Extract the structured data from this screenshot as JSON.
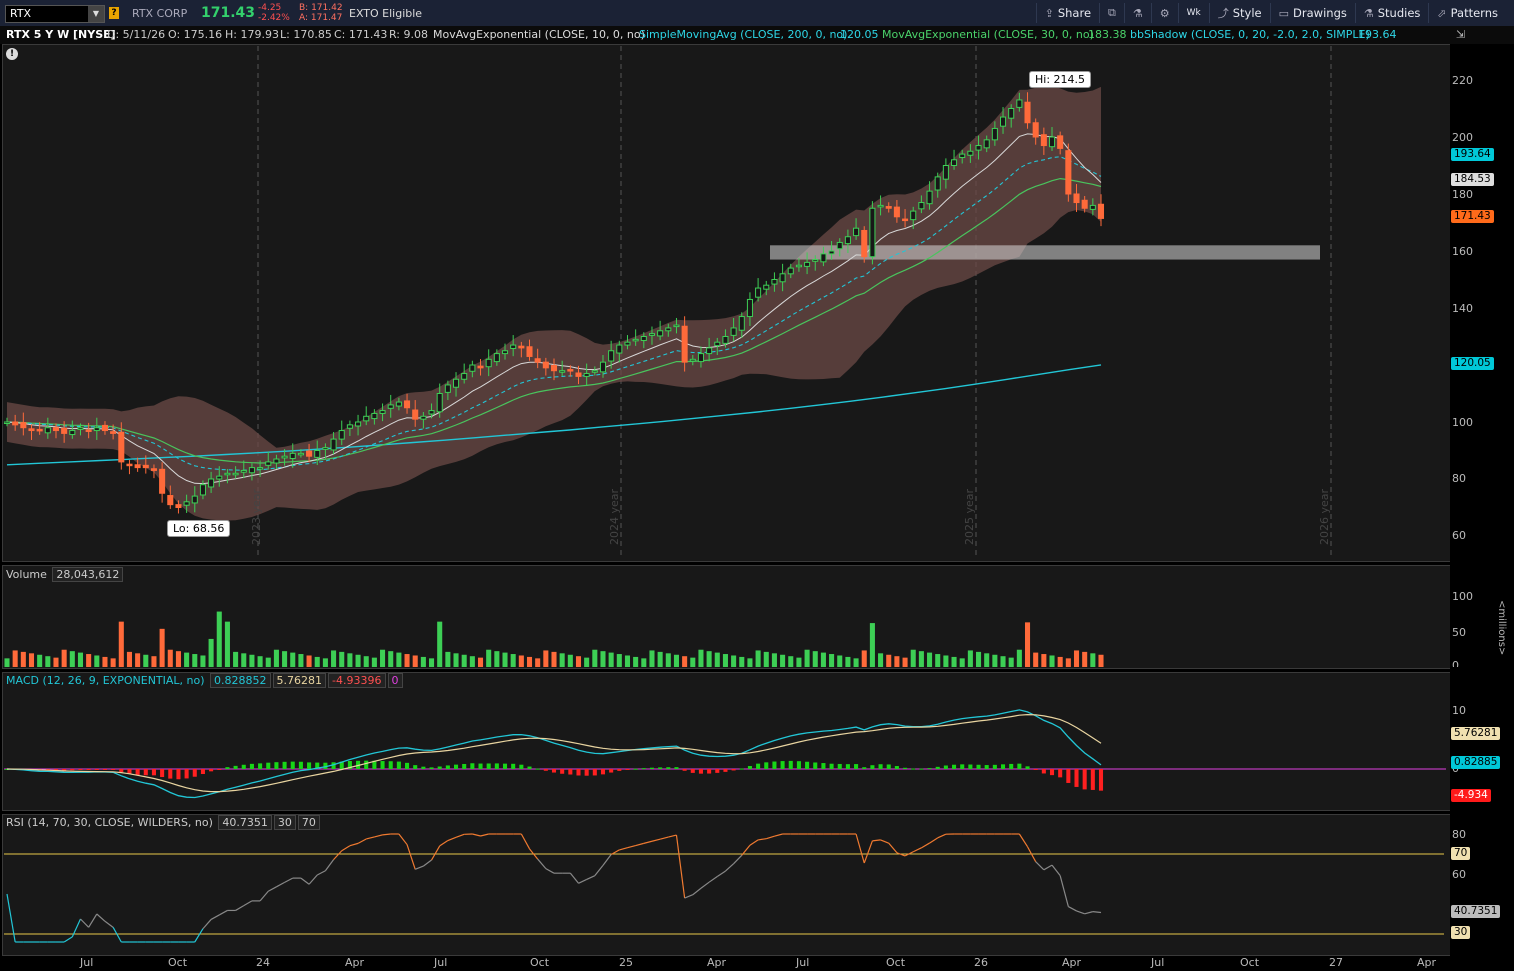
{
  "header": {
    "symbol": "RTX",
    "company": "RTX CORP",
    "last": "171.43",
    "change": "-4.25",
    "change_pct": "-2.42%",
    "bid": "B: 171.42",
    "ask": "A: 171.47",
    "exto": "EXTO Eligible"
  },
  "toolbar": {
    "share": "Share",
    "aggregation": "Wk",
    "style": "Style",
    "drawings": "Drawings",
    "studies": "Studies",
    "patterns": "Patterns"
  },
  "studybar": {
    "title": "RTX 5 Y W [NYSE]",
    "date": "D: 5/11/26",
    "open": "O: 175.16",
    "high": "H: 179.93",
    "low": "L: 170.85",
    "close": "C: 171.43",
    "range": "R: 9.08",
    "ema10": "MovAvgExponential (CLOSE, 10, 0, no)",
    "sma200": "SimpleMovingAvg (CLOSE, 200, 0, no)",
    "sma200_val": "120.05",
    "ema30": "MovAvgExponential (CLOSE, 30, 0, no)",
    "ema30_val": "183.38",
    "bb": "bbShadow (CLOSE, 0, 20, -2.0, 2.0, SIMPLE)",
    "bb_val": "193.64"
  },
  "price_pane": {
    "y_ticks": [
      "220",
      "200",
      "180",
      "160",
      "140",
      "100",
      "80",
      "60"
    ],
    "hi_label": "Hi: 214.5",
    "lo_label": "Lo: 68.56",
    "tag_bb": "193.64",
    "tag_ema": "184.53",
    "tag_last": "171.43",
    "tag_sma": "120.05",
    "years": [
      "2023 year",
      "2024 year",
      "2025 year",
      "2026 year"
    ]
  },
  "volume_pane": {
    "label": "Volume",
    "value": "28,043,612",
    "y_ticks": [
      "100",
      "50",
      "0"
    ],
    "units": "<millions>"
  },
  "macd_pane": {
    "label": "MACD (12, 26, 9, EXPONENTIAL, no)",
    "value": "0.828852",
    "avg": "5.76281",
    "diff": "-4.93396",
    "zero": "0",
    "y_ticks": [
      "10",
      "0"
    ],
    "tag_avg": "5.76281",
    "tag_value": "0.82885",
    "tag_diff": "-4.934"
  },
  "rsi_pane": {
    "label": "RSI (14, 70, 30, CLOSE, WILDERS, no)",
    "value": "40.7351",
    "os": "30",
    "ob": "70",
    "y_ticks": [
      "80",
      "60"
    ],
    "tag_ob": "70",
    "tag_val": "40.7351",
    "tag_os": "30"
  },
  "x_axis": [
    "Jul",
    "Oct",
    "24",
    "Apr",
    "Jul",
    "Oct",
    "25",
    "Apr",
    "Jul",
    "Oct",
    "26",
    "Apr",
    "Jul",
    "Oct",
    "27",
    "Apr"
  ],
  "chart_data": {
    "type": "candlestick",
    "timeframe": "weekly",
    "closes": [
      100,
      99,
      98,
      97,
      97,
      98,
      97,
      96,
      97,
      98,
      97,
      98,
      97,
      96,
      86,
      85,
      84,
      84,
      83,
      75,
      71,
      70,
      72,
      74,
      78,
      80,
      81,
      82,
      82,
      83,
      84,
      84,
      86,
      87,
      88,
      89,
      89,
      88,
      90,
      91,
      94,
      97,
      99,
      100,
      102,
      103,
      104,
      106,
      107,
      105,
      101,
      102,
      104,
      110,
      113,
      115,
      117,
      120,
      119,
      122,
      124,
      125,
      127,
      126,
      123,
      121,
      119,
      118,
      118,
      118,
      116,
      117,
      118,
      121,
      125,
      127,
      128,
      129,
      130,
      131,
      132,
      133,
      134,
      121,
      122,
      124,
      126,
      128,
      130,
      133,
      137,
      143,
      147,
      148,
      150,
      152,
      154,
      155,
      156,
      157,
      159,
      160,
      163,
      165,
      168,
      158,
      175,
      176,
      175,
      172,
      171,
      174,
      177,
      181,
      186,
      190,
      192,
      194,
      195,
      197,
      199,
      203,
      207,
      210,
      213,
      205,
      200,
      197,
      200,
      196,
      180,
      177,
      175,
      176,
      171.43
    ],
    "sma200": [
      85,
      85.5,
      86,
      86.5,
      87,
      87.5,
      88,
      88.6,
      89.2,
      89.8,
      90.5,
      91.2,
      92,
      92.8,
      93.6,
      94.5,
      95.4,
      96.3,
      97.2,
      98.2,
      99.2,
      100.2,
      101.3,
      102.4,
      103.5,
      104.7,
      106,
      107.3,
      108.7,
      110.2,
      111.7,
      113.3,
      115,
      116.7,
      118.4,
      120.05
    ],
    "y_range": [
      55,
      228
    ],
    "shaded_zone": [
      157,
      162
    ],
    "macd": {
      "value": 0.828852,
      "avg": 5.76281,
      "diff": -4.93396,
      "y_range": [
        -13,
        16
      ]
    },
    "rsi": {
      "last": 40.7351,
      "overbought": 70,
      "oversold": 30,
      "y_range": [
        26,
        82
      ]
    }
  }
}
